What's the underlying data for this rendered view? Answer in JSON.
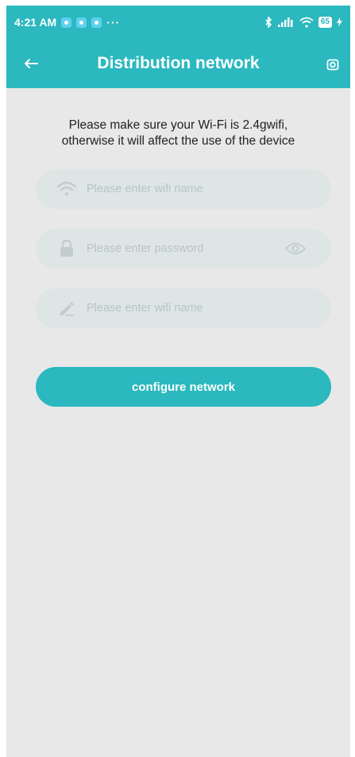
{
  "status_bar": {
    "time": "4:21 AM",
    "more": "···",
    "battery": "65"
  },
  "header": {
    "title": "Distribution network",
    "back_icon": "arrow-left-icon",
    "action_icon": "camera-icon"
  },
  "notice": {
    "line1": "Please make sure your Wi-Fi is 2.4gwifi,",
    "line2": "otherwise it will affect the use of the device"
  },
  "form": {
    "wifi_name": {
      "value": "",
      "placeholder": "Please enter wifi name",
      "icon": "wifi-icon"
    },
    "password": {
      "value": "",
      "placeholder": "Please enter password",
      "icon": "lock-icon",
      "toggle_icon": "eye-icon"
    },
    "device_name": {
      "value": "",
      "placeholder": "Please enter wifi name",
      "icon": "pencil-icon"
    }
  },
  "submit": {
    "label": "configure network"
  },
  "colors": {
    "primary": "#2bb8bf",
    "background": "#e8e8e8",
    "field_bg": "#dde6e5",
    "placeholder": "#b8c4c3",
    "icon": "#c2cccb"
  }
}
